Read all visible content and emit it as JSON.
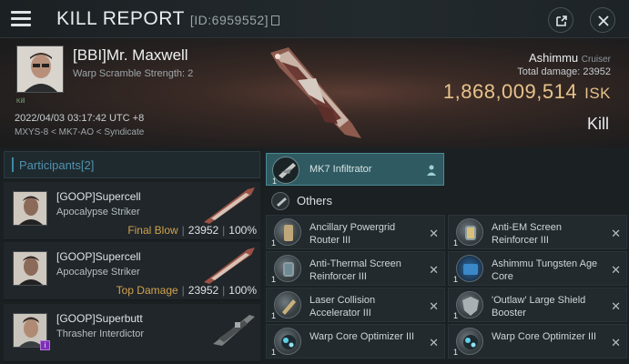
{
  "header": {
    "title": "KILL REPORT",
    "report_id": "[ID:6959552]"
  },
  "victim": {
    "name": "[BBI]Mr. Maxwell",
    "warp_scramble": "Warp Scramble Strength: 2",
    "badge": "Kill",
    "datetime": "2022/04/03 03:17:42 UTC +8",
    "location": "MXYS-8 < MK7-AO < Syndicate",
    "ship_name": "Ashimmu",
    "ship_class": "Cruiser",
    "total_damage_label": "Total damage:",
    "total_damage": "23952",
    "isk_value": "1,868,009,514",
    "isk_unit": "ISK",
    "result": "Kill"
  },
  "participants": {
    "title": "Participants",
    "count": "[2]",
    "rows": [
      {
        "name": "[GOOP]Supercell",
        "ship": "Apocalypse Striker",
        "tag": "Final Blow",
        "damage": "23952",
        "percent": "100%"
      },
      {
        "name": "[GOOP]Supercell",
        "ship": "Apocalypse Striker",
        "tag": "Top Damage",
        "damage": "23952",
        "percent": "100%"
      },
      {
        "name": "[GOOP]Superbutt",
        "ship": "Thrasher Interdictor",
        "tag": "",
        "damage": "",
        "percent": ""
      }
    ]
  },
  "items": {
    "selected": {
      "label": "MK7  Infiltrator",
      "qty": "1"
    },
    "others_label": "Others",
    "list": [
      {
        "name": "Ancillary Powergrid Router III",
        "qty": "1"
      },
      {
        "name": "Anti-EM Screen Reinforcer III",
        "qty": "1"
      },
      {
        "name": "Anti-Thermal Screen Reinforcer III",
        "qty": "1"
      },
      {
        "name": "Ashimmu Tungsten Age Core",
        "qty": "1"
      },
      {
        "name": "Laser Collision Accelerator III",
        "qty": "1"
      },
      {
        "name": "'Outlaw' Large Shield Booster",
        "qty": "1"
      },
      {
        "name": "Warp Core Optimizer III",
        "qty": "1"
      },
      {
        "name": "Warp Core Optimizer III",
        "qty": "1"
      }
    ]
  },
  "colors": {
    "accent": "#4f92ad",
    "isk": "#e7c38b",
    "tag": "#d2a24b",
    "selected_bg": "#2f5a61"
  }
}
